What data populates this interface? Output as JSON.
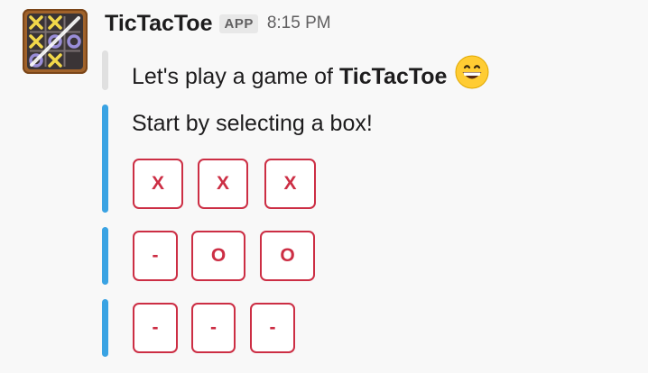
{
  "message": {
    "app_name": "TicTacToe",
    "app_badge": "APP",
    "timestamp": "8:15 PM",
    "intro_prefix": "Let's play a game of",
    "intro_bold": "TicTacToe",
    "intro_emoji": "grinning-face-emoji",
    "prompt": "Start by selecting a box!"
  },
  "board": {
    "row1": [
      "X",
      "X",
      "X"
    ],
    "row2": [
      "-",
      "O",
      "O"
    ],
    "row3": [
      "-",
      "-",
      "-"
    ]
  },
  "colors": {
    "accent_bar": "#3aa3e3",
    "button_red": "#cc2e44",
    "background": "#f8f8f8"
  }
}
